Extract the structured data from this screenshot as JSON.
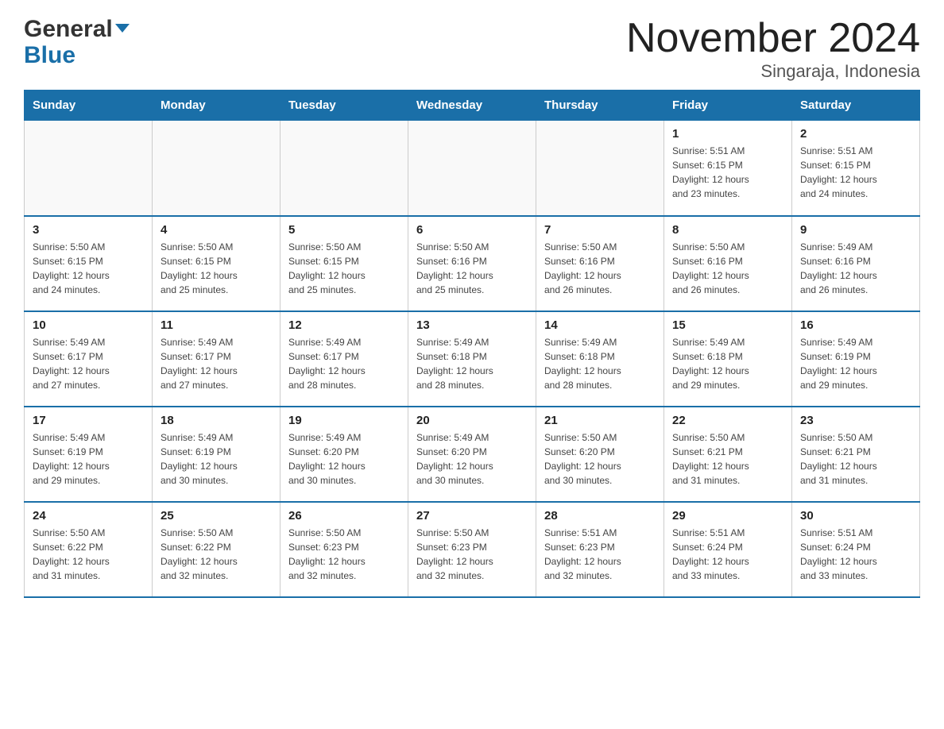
{
  "header": {
    "title": "November 2024",
    "subtitle": "Singaraja, Indonesia",
    "logo_general": "General",
    "logo_blue": "Blue"
  },
  "weekdays": [
    "Sunday",
    "Monday",
    "Tuesday",
    "Wednesday",
    "Thursday",
    "Friday",
    "Saturday"
  ],
  "weeks": [
    [
      {
        "day": "",
        "info": ""
      },
      {
        "day": "",
        "info": ""
      },
      {
        "day": "",
        "info": ""
      },
      {
        "day": "",
        "info": ""
      },
      {
        "day": "",
        "info": ""
      },
      {
        "day": "1",
        "info": "Sunrise: 5:51 AM\nSunset: 6:15 PM\nDaylight: 12 hours\nand 23 minutes."
      },
      {
        "day": "2",
        "info": "Sunrise: 5:51 AM\nSunset: 6:15 PM\nDaylight: 12 hours\nand 24 minutes."
      }
    ],
    [
      {
        "day": "3",
        "info": "Sunrise: 5:50 AM\nSunset: 6:15 PM\nDaylight: 12 hours\nand 24 minutes."
      },
      {
        "day": "4",
        "info": "Sunrise: 5:50 AM\nSunset: 6:15 PM\nDaylight: 12 hours\nand 25 minutes."
      },
      {
        "day": "5",
        "info": "Sunrise: 5:50 AM\nSunset: 6:15 PM\nDaylight: 12 hours\nand 25 minutes."
      },
      {
        "day": "6",
        "info": "Sunrise: 5:50 AM\nSunset: 6:16 PM\nDaylight: 12 hours\nand 25 minutes."
      },
      {
        "day": "7",
        "info": "Sunrise: 5:50 AM\nSunset: 6:16 PM\nDaylight: 12 hours\nand 26 minutes."
      },
      {
        "day": "8",
        "info": "Sunrise: 5:50 AM\nSunset: 6:16 PM\nDaylight: 12 hours\nand 26 minutes."
      },
      {
        "day": "9",
        "info": "Sunrise: 5:49 AM\nSunset: 6:16 PM\nDaylight: 12 hours\nand 26 minutes."
      }
    ],
    [
      {
        "day": "10",
        "info": "Sunrise: 5:49 AM\nSunset: 6:17 PM\nDaylight: 12 hours\nand 27 minutes."
      },
      {
        "day": "11",
        "info": "Sunrise: 5:49 AM\nSunset: 6:17 PM\nDaylight: 12 hours\nand 27 minutes."
      },
      {
        "day": "12",
        "info": "Sunrise: 5:49 AM\nSunset: 6:17 PM\nDaylight: 12 hours\nand 28 minutes."
      },
      {
        "day": "13",
        "info": "Sunrise: 5:49 AM\nSunset: 6:18 PM\nDaylight: 12 hours\nand 28 minutes."
      },
      {
        "day": "14",
        "info": "Sunrise: 5:49 AM\nSunset: 6:18 PM\nDaylight: 12 hours\nand 28 minutes."
      },
      {
        "day": "15",
        "info": "Sunrise: 5:49 AM\nSunset: 6:18 PM\nDaylight: 12 hours\nand 29 minutes."
      },
      {
        "day": "16",
        "info": "Sunrise: 5:49 AM\nSunset: 6:19 PM\nDaylight: 12 hours\nand 29 minutes."
      }
    ],
    [
      {
        "day": "17",
        "info": "Sunrise: 5:49 AM\nSunset: 6:19 PM\nDaylight: 12 hours\nand 29 minutes."
      },
      {
        "day": "18",
        "info": "Sunrise: 5:49 AM\nSunset: 6:19 PM\nDaylight: 12 hours\nand 30 minutes."
      },
      {
        "day": "19",
        "info": "Sunrise: 5:49 AM\nSunset: 6:20 PM\nDaylight: 12 hours\nand 30 minutes."
      },
      {
        "day": "20",
        "info": "Sunrise: 5:49 AM\nSunset: 6:20 PM\nDaylight: 12 hours\nand 30 minutes."
      },
      {
        "day": "21",
        "info": "Sunrise: 5:50 AM\nSunset: 6:20 PM\nDaylight: 12 hours\nand 30 minutes."
      },
      {
        "day": "22",
        "info": "Sunrise: 5:50 AM\nSunset: 6:21 PM\nDaylight: 12 hours\nand 31 minutes."
      },
      {
        "day": "23",
        "info": "Sunrise: 5:50 AM\nSunset: 6:21 PM\nDaylight: 12 hours\nand 31 minutes."
      }
    ],
    [
      {
        "day": "24",
        "info": "Sunrise: 5:50 AM\nSunset: 6:22 PM\nDaylight: 12 hours\nand 31 minutes."
      },
      {
        "day": "25",
        "info": "Sunrise: 5:50 AM\nSunset: 6:22 PM\nDaylight: 12 hours\nand 32 minutes."
      },
      {
        "day": "26",
        "info": "Sunrise: 5:50 AM\nSunset: 6:23 PM\nDaylight: 12 hours\nand 32 minutes."
      },
      {
        "day": "27",
        "info": "Sunrise: 5:50 AM\nSunset: 6:23 PM\nDaylight: 12 hours\nand 32 minutes."
      },
      {
        "day": "28",
        "info": "Sunrise: 5:51 AM\nSunset: 6:23 PM\nDaylight: 12 hours\nand 32 minutes."
      },
      {
        "day": "29",
        "info": "Sunrise: 5:51 AM\nSunset: 6:24 PM\nDaylight: 12 hours\nand 33 minutes."
      },
      {
        "day": "30",
        "info": "Sunrise: 5:51 AM\nSunset: 6:24 PM\nDaylight: 12 hours\nand 33 minutes."
      }
    ]
  ]
}
